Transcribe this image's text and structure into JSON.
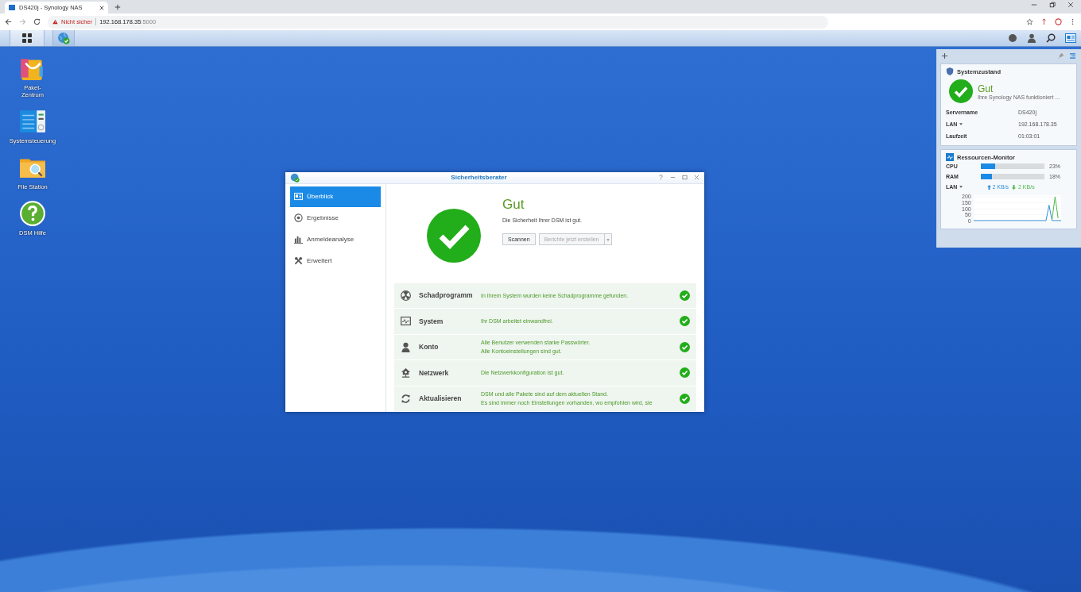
{
  "browser": {
    "tab_title": "DS420j - Synology NAS",
    "url_warning": "Nicht sicher",
    "url_host": "192.168.178.35",
    "url_port": ":5000"
  },
  "desktop_icons": [
    {
      "kind": "package",
      "label_lines": [
        "Paket-",
        "Zentrum"
      ]
    },
    {
      "kind": "control",
      "label_lines": [
        "Systemsteuerung"
      ]
    },
    {
      "kind": "folder",
      "label_lines": [
        "File Station"
      ]
    },
    {
      "kind": "help",
      "label_lines": [
        "DSM Hilfe"
      ]
    }
  ],
  "window": {
    "title": "Sicherheitsberater",
    "sidebar": [
      {
        "kind": "overview",
        "label": "Überblick",
        "selected": true
      },
      {
        "kind": "results",
        "label": "Ergebnisse",
        "selected": false
      },
      {
        "kind": "login",
        "label": "Anmeldeanalyse",
        "selected": false
      },
      {
        "kind": "advanced",
        "label": "Erweitert",
        "selected": false
      }
    ],
    "status": {
      "ok": true,
      "title": "Gut",
      "message": "Die Sicherheit Ihrer DSM ist gut.",
      "buttons": [
        {
          "label": "Scannen",
          "disabled": false
        },
        {
          "label": "Berichte jetzt erstellen",
          "disabled": true
        }
      ]
    },
    "checks": [
      {
        "kind": "malware",
        "name": "Schadprogramm",
        "ok": true,
        "lines": [
          "In Ihrem System wurden keine Schadprogramme gefunden."
        ]
      },
      {
        "kind": "system",
        "name": "System",
        "ok": true,
        "lines": [
          "Ihr DSM arbeitet einwandfrei."
        ]
      },
      {
        "kind": "account",
        "name": "Konto",
        "ok": true,
        "lines": [
          "Alle Benutzer verwenden starke Passwörter.",
          "Alle Kontoeinstellungen sind gut."
        ]
      },
      {
        "kind": "network",
        "name": "Netzwerk",
        "ok": true,
        "lines": [
          "Die Netzwerkkonfiguration ist gut."
        ]
      },
      {
        "kind": "update",
        "name": "Aktualisieren",
        "ok": true,
        "lines": [
          "DSM und alle Pakete sind auf dem aktuellen Stand.",
          "Es sind immer noch Einstellungen vorhanden, wo empfohlen wird, sie"
        ]
      }
    ]
  },
  "widgets": {
    "health": {
      "title": "Systemzustand",
      "ok": true,
      "status": "Gut",
      "message": "Ihre Synology NAS funktioniert …",
      "rows": [
        {
          "label": "Servername",
          "value": "DS420j",
          "dropdown": false
        },
        {
          "label": "LAN",
          "value": "192.168.178.35",
          "dropdown": true
        },
        {
          "label": "Laufzeit",
          "value": "01:03:01",
          "dropdown": false
        }
      ]
    },
    "resources": {
      "title": "Ressourcen-Monitor",
      "meters": [
        {
          "label": "CPU",
          "level": 0.23,
          "reading": "23%"
        },
        {
          "label": "RAM",
          "level": 0.18,
          "reading": "18%"
        }
      ],
      "lan": {
        "label": "LAN",
        "dropdown": true,
        "up": "2 KB/s",
        "down": "2 KB/s"
      },
      "chart_data": {
        "type": "line",
        "ylim": [
          0,
          200
        ],
        "yticks": [
          0,
          50,
          100,
          150,
          200
        ],
        "series": [
          {
            "color": "#2f8fd8",
            "values": [
              0,
              0,
              0,
              0,
              0,
              0,
              0,
              0,
              0,
              0,
              0,
              0,
              0,
              0,
              0,
              0,
              0,
              0,
              0,
              0,
              0,
              0,
              0,
              0,
              0,
              130,
              0,
              0,
              0,
              0
            ]
          },
          {
            "color": "#4cb84c",
            "values": [
              null,
              null,
              null,
              null,
              null,
              null,
              null,
              null,
              null,
              null,
              null,
              null,
              null,
              null,
              null,
              null,
              null,
              null,
              null,
              null,
              null,
              null,
              null,
              null,
              null,
              null,
              10,
              200,
              20,
              null
            ]
          }
        ]
      }
    }
  }
}
